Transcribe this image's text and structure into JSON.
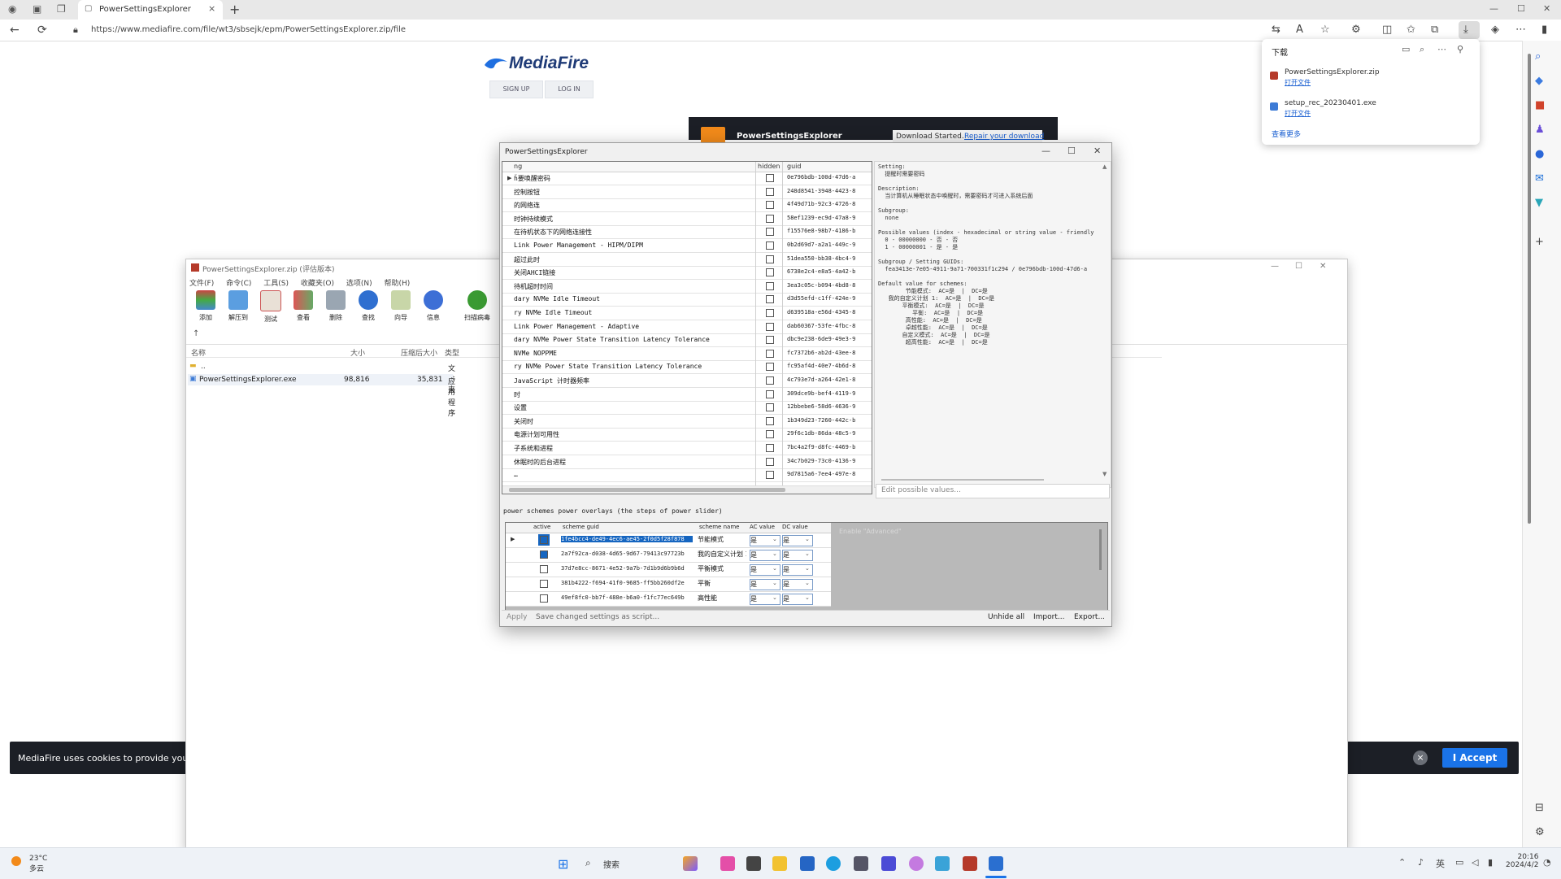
{
  "browser": {
    "tab_title": "PowerSettingsExplorer",
    "tab_close": "×",
    "new_tab": "+",
    "url": "https://www.mediafire.com/file/wt3/sbsejk/epm/PowerSettingsExplorer.zip/file",
    "nav_back": "←",
    "nav_refresh": "⟳",
    "win_min": "—",
    "win_max": "☐",
    "downloads": {
      "header": "下载",
      "items": [
        {
          "name": "PowerSettingsExplorer.zip",
          "action": "打开文件"
        },
        {
          "name": "setup_rec_20230401.exe",
          "action": "打开文件"
        }
      ],
      "more": "查看更多"
    }
  },
  "mediafire": {
    "logo": "MediaFire",
    "sign_up": "SIGN UP",
    "log_in": "LOG IN",
    "panel_name": "PowerSettingsExplorer",
    "download_started": "Download Started.",
    "repair_link": "Repair your download",
    "cookie_text": "MediaFire uses cookies to provide you with",
    "cookie_accept": "I Accept",
    "cookie_close": "×"
  },
  "winrar": {
    "title": "PowerSettingsExplorer.zip (评估版本)",
    "menu": [
      "文件(F)",
      "命令(C)",
      "工具(S)",
      "收藏夹(O)",
      "选项(N)",
      "帮助(H)"
    ],
    "tools": [
      "添加",
      "解压到",
      "测试",
      "查看",
      "删除",
      "查找",
      "向导",
      "信息",
      "扫描病毒"
    ],
    "columns": [
      "名称",
      "大小",
      "压缩后大小",
      "类型"
    ],
    "rows": [
      {
        "name": "..",
        "size": "",
        "packed": "",
        "type": "文件夹"
      },
      {
        "name": "PowerSettingsExplorer.exe",
        "size": "98,816",
        "packed": "35,831",
        "type": "应用程序"
      }
    ]
  },
  "pse": {
    "title": "PowerSettingsExplorer",
    "columns": [
      "ng",
      "hidden",
      "guid"
    ],
    "rows": [
      {
        "name": "ȟ要唤醒密码",
        "guid": "0e796bdb-100d-47d6-a"
      },
      {
        "name": "控制按钮",
        "guid": "248d8541-3948-4423-8"
      },
      {
        "name": "的网络连",
        "guid": "4f49d71b-92c3-4726-8"
      },
      {
        "name": "时钟持续模式",
        "guid": "58ef1239-ec9d-47a8-9"
      },
      {
        "name": "在待机状态下的网络连接性",
        "guid": "f15576e8-98b7-4186-b"
      },
      {
        "name": "Link Power Management - HIPM/DIPM",
        "guid": "0b2d69d7-a2a1-449c-9"
      },
      {
        "name": "超过此时",
        "guid": "51dea550-bb38-4bc4-9"
      },
      {
        "name": "关闭AHCI链接",
        "guid": "6738e2c4-e8a5-4a42-b"
      },
      {
        "name": "待机超时时间",
        "guid": "3ea3c05c-b094-4bd8-8"
      },
      {
        "name": "dary NVMe Idle Timeout",
        "guid": "d3d55efd-c1ff-424e-9"
      },
      {
        "name": "ry NVMe Idle Timeout",
        "guid": "d639518a-e56d-4345-8"
      },
      {
        "name": "Link Power Management - Adaptive",
        "guid": "dab60367-53fe-4fbc-8"
      },
      {
        "name": "dary NVMe Power State Transition Latency Tolerance",
        "guid": "dbc9e238-6de9-49e3-9"
      },
      {
        "name": "NVMe NOPPME",
        "guid": "fc7372b6-ab2d-43ee-8"
      },
      {
        "name": "ry NVMe Power State Transition Latency Tolerance",
        "guid": "fc95af4d-40e7-4b6d-8"
      },
      {
        "name": "JavaScript 计时器频率",
        "guid": "4c793e7d-a264-42e1-8"
      },
      {
        "name": "时",
        "guid": "309dce9b-bef4-4119-9"
      },
      {
        "name": "设置",
        "guid": "12bbebe6-58d6-4636-9"
      },
      {
        "name": "关闭时",
        "guid": "1b349d23-7260-442c-b"
      },
      {
        "name": "电源计划可用性",
        "guid": "29f6c1db-86da-48c5-9"
      },
      {
        "name": "子系统和进程",
        "guid": "7bc4a2f9-d8fc-4469-b"
      },
      {
        "name": "休眠时的后台进程",
        "guid": "34c7b029-73c0-4136-9"
      },
      {
        "name": "…",
        "guid": "9d7815a6-7ee4-497e-8"
      }
    ],
    "description": "Setting:\n  提醒时需要密码\n\nDescription:\n  当计算机从睡眠状态中唤醒时，需要密码才可进入系统后面\n\nSubgroup:\n  none\n\nPossible values (index - hexadecimal or string value - friendly\n  0 - 00000000 - 否 - 否\n  1 - 00000001 - 是 - 是\n\nSubgroup / Setting GUIDs:\n  fea3413e-7e05-4911-9a71-700331f1c294 / 0e796bdb-100d-47d6-a\n\nDefault value for schemes:\n        节能模式:  AC=是  |  DC=是\n   我的自定义计划 1:  AC=是  |  DC=是\n       平衡模式:  AC=是  |  DC=是\n          平衡:  AC=是  |  DC=是\n        高性能:  AC=是  |  DC=是\n        卓越性能:  AC=是  |  DC=是\n       自定义模式:  AC=是  |  DC=是\n        超高性能:  AC=是  |  DC=是",
    "edit_placeholder": "Edit possible values...",
    "overlay_label": "power schemes  power overlays (the steps of power slider)",
    "sub_columns": [
      "active",
      "scheme guid",
      "scheme name",
      "AC value",
      "DC value"
    ],
    "sub_rows": [
      {
        "guid": "1fe4bcc4-de49-4ec6-ae45-2f0d5f28f878",
        "name": "节能模式",
        "ac": "是",
        "dc": "是"
      },
      {
        "guid": "2a7f92ca-d038-4d65-9d67-79413c97723b",
        "name": "我的自定义计划 1",
        "ac": "是",
        "dc": "是"
      },
      {
        "guid": "37d7e8cc-8671-4e52-9a7b-7d1b9d6b9b6d",
        "name": "平衡模式",
        "ac": "是",
        "dc": "是"
      },
      {
        "guid": "381b4222-f694-41f0-9685-ff5bb260df2e",
        "name": "平衡",
        "ac": "是",
        "dc": "是"
      },
      {
        "guid": "49ef8fc0-bb7f-488e-b6a0-f1fc77ec649b",
        "name": "高性能",
        "ac": "是",
        "dc": "是"
      }
    ],
    "sub_ghost_text": "Enable \"Advanced\"",
    "apply": "Apply",
    "save_script": "Save changed settings as script...",
    "unhide_all": "Unhide all",
    "import": "Import...",
    "export": "Export..."
  },
  "taskbar": {
    "weather_temp": "23°C",
    "weather_desc": "多云",
    "search": "搜索",
    "time": "20:16",
    "date": "2024/4/2"
  },
  "colors": {
    "accent": "#1a73e8",
    "mediafire_dark": "#1c1f26",
    "mediafire_orange": "#f28a1a",
    "selection_blue": "#1565c0"
  }
}
